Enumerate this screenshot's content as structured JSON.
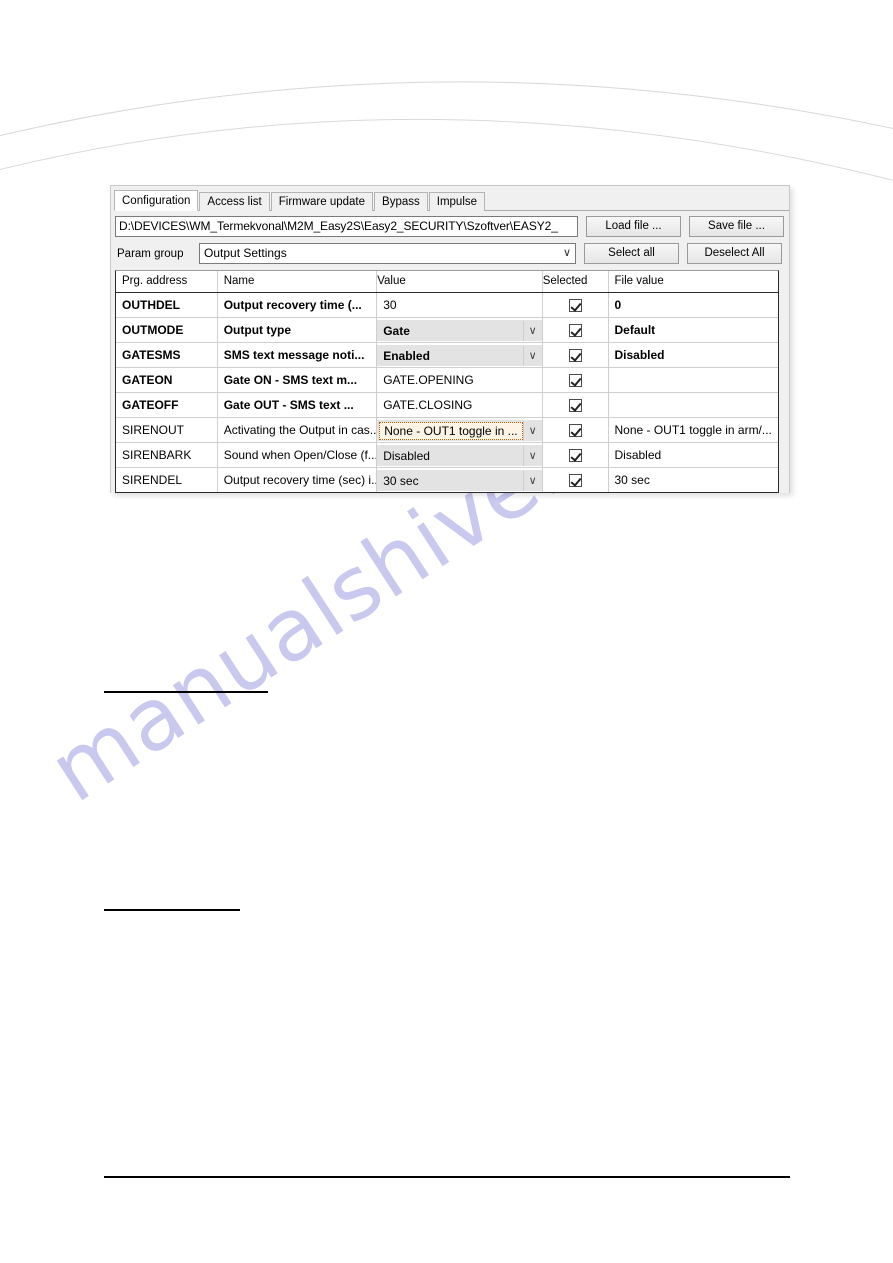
{
  "window": {
    "tabs": [
      {
        "label": "Configuration",
        "active": true
      },
      {
        "label": "Access list",
        "active": false
      },
      {
        "label": "Firmware update",
        "active": false
      },
      {
        "label": "Bypass",
        "active": false
      },
      {
        "label": "Impulse",
        "active": false
      }
    ],
    "file_path": "D:\\DEVICES\\WM_Termekvonal\\M2M_Easy2S\\Easy2_SECURITY\\Szoftver\\EASY2_",
    "buttons": {
      "load_file": "Load file ...",
      "save_file": "Save file ...",
      "select_all": "Select all",
      "deselect_all": "Deselect All"
    },
    "param_group": {
      "label": "Param group",
      "value": "Output Settings"
    },
    "grid": {
      "headers": [
        "Prg. address",
        "Name",
        "Value",
        "Selected",
        "File value"
      ],
      "rows": [
        {
          "address": "OUTHDEL",
          "name": "Output recovery time (...",
          "value": "30",
          "value_kind": "text",
          "selected": true,
          "file_value": "0",
          "bold": true,
          "focused": false
        },
        {
          "address": "OUTMODE",
          "name": "Output type",
          "value": "Gate",
          "value_kind": "combo",
          "selected": true,
          "file_value": "Default",
          "bold": true,
          "focused": false
        },
        {
          "address": "GATESMS",
          "name": "SMS text message noti...",
          "value": "Enabled",
          "value_kind": "combo",
          "selected": true,
          "file_value": "Disabled",
          "bold": true,
          "focused": false
        },
        {
          "address": "GATEON",
          "name": "Gate ON - SMS text m...",
          "value": "GATE.OPENING",
          "value_kind": "text",
          "selected": true,
          "file_value": "",
          "bold": true,
          "focused": false
        },
        {
          "address": "GATEOFF",
          "name": "Gate OUT - SMS text ...",
          "value": "GATE.CLOSING",
          "value_kind": "text",
          "selected": true,
          "file_value": "",
          "bold": true,
          "focused": false
        },
        {
          "address": "SIRENOUT",
          "name": "Activating the Output in cas...",
          "value": "None - OUT1 toggle in ...",
          "value_kind": "combo",
          "selected": true,
          "file_value": "None - OUT1 toggle in arm/...",
          "bold": false,
          "focused": true
        },
        {
          "address": "SIRENBARK",
          "name": "Sound when Open/Close (f...",
          "value": "Disabled",
          "value_kind": "combo",
          "selected": true,
          "file_value": "Disabled",
          "bold": false,
          "focused": false
        },
        {
          "address": "SIRENDEL",
          "name": "Output recovery time (sec) i...",
          "value": "30 sec",
          "value_kind": "combo",
          "selected": true,
          "file_value": "30 sec",
          "bold": false,
          "focused": false
        }
      ]
    },
    "icons": {
      "chevron_down": "∨"
    }
  },
  "page": {
    "watermark": "manualshive.com"
  }
}
